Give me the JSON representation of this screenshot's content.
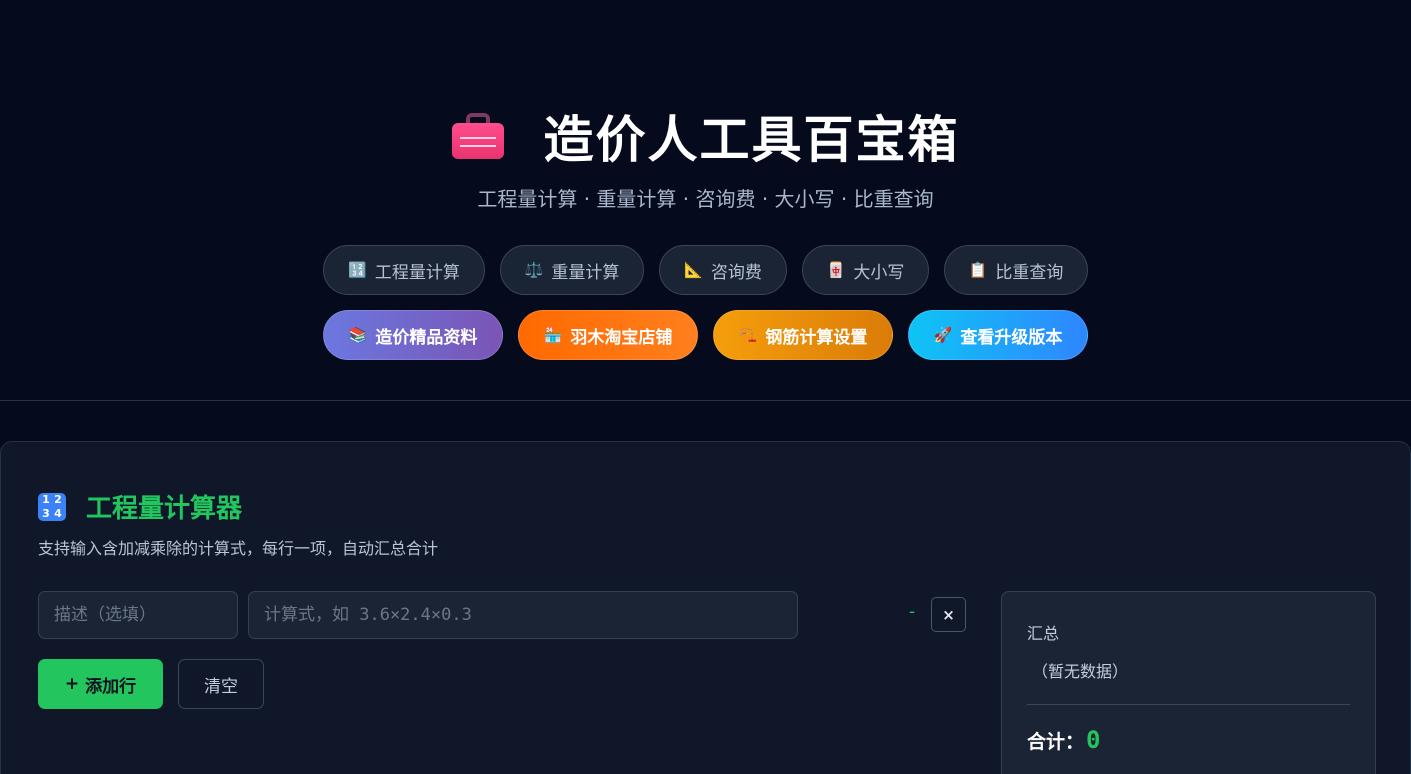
{
  "header": {
    "title": "造价人工具百宝箱",
    "subtitle": "工程量计算 · 重量计算 · 咨询费 · 大小写 · 比重查询"
  },
  "nav_tabs": [
    {
      "icon": "🔢",
      "label": "工程量计算"
    },
    {
      "icon": "⚖️",
      "label": "重量计算"
    },
    {
      "icon": "📐",
      "label": "咨询费"
    },
    {
      "icon": "🀄",
      "label": "大小写"
    },
    {
      "icon": "📋",
      "label": "比重查询"
    }
  ],
  "promo_buttons": [
    {
      "icon": "📚",
      "label": "造价精品资料",
      "color": "#6b78e0"
    },
    {
      "icon": "🏪",
      "label": "羽木淘宝店铺",
      "color": "#ff6a00"
    },
    {
      "icon": "🏗️",
      "label": "钢筋计算设置",
      "color": "#f59e0b"
    },
    {
      "icon": "🚀",
      "label": "查看升级版本",
      "color": "#0ec4f5"
    }
  ],
  "calculator": {
    "icon": "1234-icon",
    "icon_digits": [
      "1",
      "2",
      "3",
      "4"
    ],
    "title": "工程量计算器",
    "description": "支持输入含加减乘除的计算式，每行一项，自动汇总合计",
    "rows": [
      {
        "desc_placeholder": "描述（选填）",
        "formula_placeholder": "计算式，如 3.6×2.4×0.3",
        "result": "-",
        "delete_label": "×"
      }
    ],
    "add_row_icon": "+",
    "add_row_label": "添加行",
    "clear_label": "清空"
  },
  "summary": {
    "label": "汇总",
    "empty_text": "（暂无数据）",
    "total_label": "合计：",
    "total_value": "0"
  },
  "colors": {
    "background": "#050a1c",
    "accent_green": "#22c55e",
    "panel": "#0f1729"
  }
}
